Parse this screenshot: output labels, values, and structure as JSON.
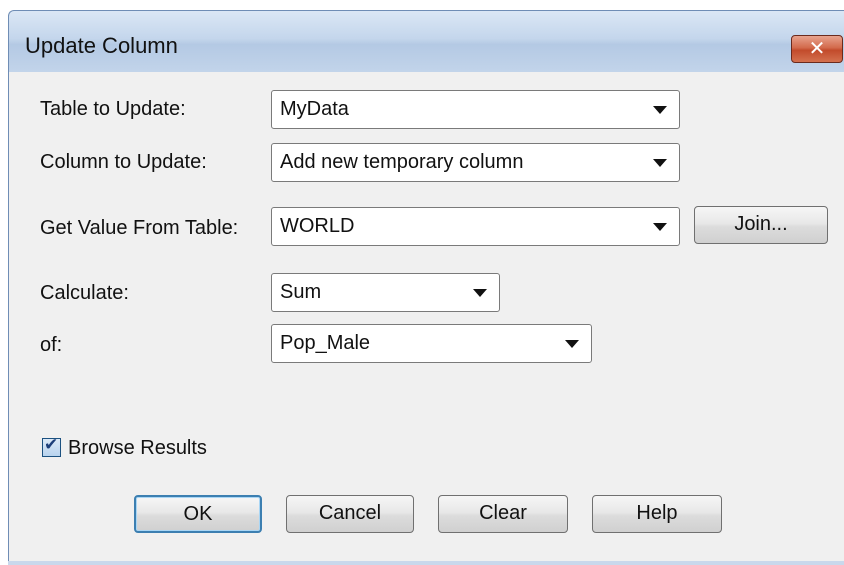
{
  "window": {
    "title": "Update Column",
    "close_glyph": "✕"
  },
  "form": {
    "table_to_update": {
      "label": "Table to Update:",
      "value": "MyData"
    },
    "column_to_update": {
      "label": "Column to Update:",
      "value": "Add new temporary column"
    },
    "get_value_from_table": {
      "label": "Get Value From Table:",
      "value": "WORLD"
    },
    "join_label": "Join...",
    "calculate": {
      "label": "Calculate:",
      "value": "Sum"
    },
    "of": {
      "label": "of:",
      "value": "Pop_Male"
    },
    "browse_results": {
      "label": "Browse Results",
      "checked": true
    }
  },
  "buttons": {
    "ok": "OK",
    "cancel": "Cancel",
    "clear": "Clear",
    "help": "Help"
  },
  "colors": {
    "titlebar": "#c4d6ec",
    "close_button": "#c24b2b",
    "dialog_background": "#f0f0f0",
    "default_button_border": "#3c7fb1"
  }
}
